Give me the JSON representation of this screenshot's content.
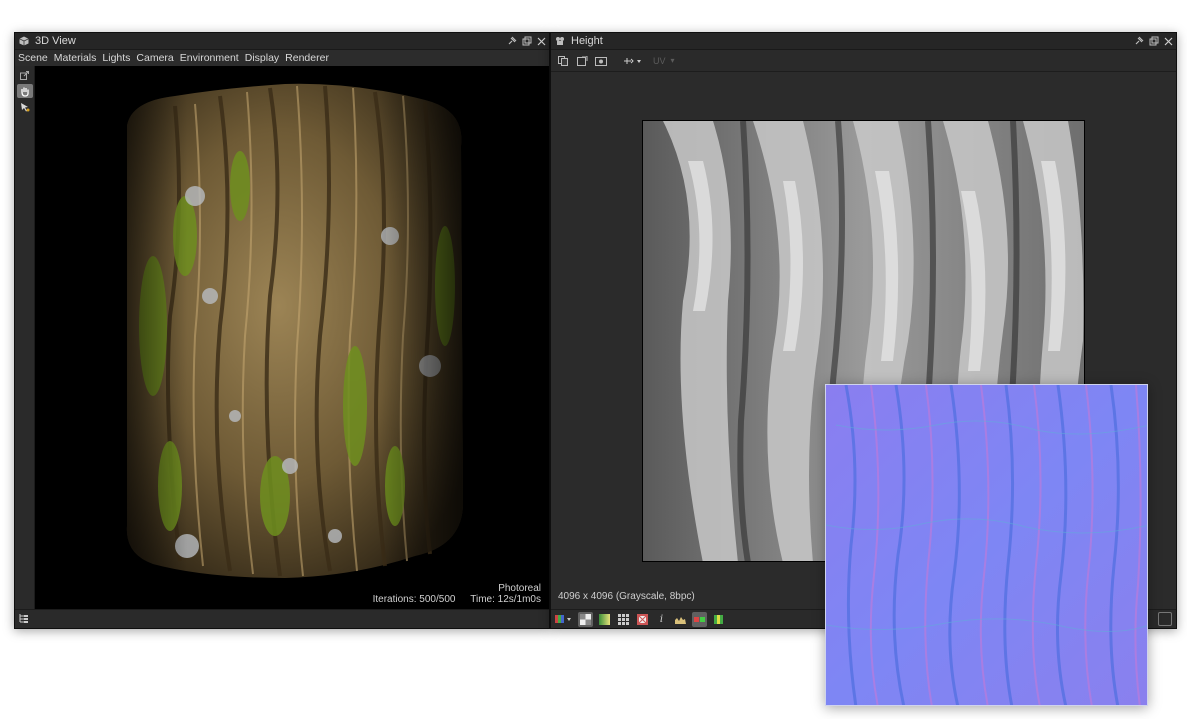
{
  "view3d": {
    "title": "3D View",
    "menu": [
      "Scene",
      "Materials",
      "Lights",
      "Camera",
      "Environment",
      "Display",
      "Renderer"
    ],
    "render_mode": "Photoreal",
    "iterations": "Iterations: 500/500",
    "time": "Time: 12s/1m0s"
  },
  "height_view": {
    "title": "Height",
    "uv_label": "UV",
    "image_info": "4096 x 4096 (Grayscale, 8bpc)"
  },
  "colors": {
    "panel_bg": "#2e2e2e",
    "viewport_bg": "#000000",
    "normal_map_base": "#7f83f0",
    "bark_base": "#6b5a38",
    "moss": "#6f8f1f"
  }
}
